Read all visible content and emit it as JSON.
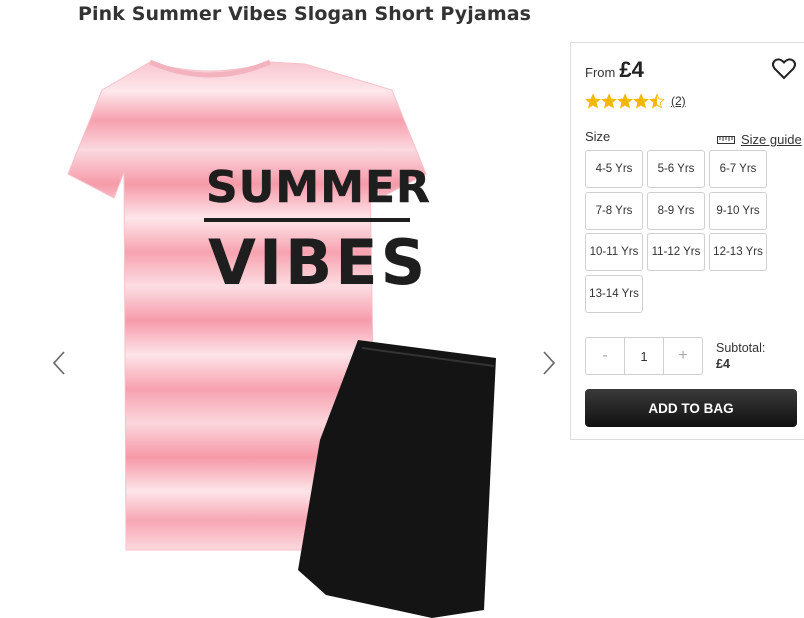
{
  "product": {
    "title": "Pink Summer Vibes Slogan Short Pyjamas",
    "image_text": [
      "SUMMER",
      "VIBES"
    ]
  },
  "purchase": {
    "from_label": "From",
    "price": "£4",
    "rating_value": 4.5,
    "rating_max": 5,
    "review_count": "(2)",
    "size_label": "Size",
    "size_guide_label": "Size guide",
    "sizes": [
      "4-5 Yrs",
      "5-6 Yrs",
      "6-7 Yrs",
      "7-8 Yrs",
      "8-9 Yrs",
      "9-10 Yrs",
      "10-11 Yrs",
      "11-12 Yrs",
      "12-13 Yrs",
      "13-14 Yrs"
    ],
    "quantity_minus": "-",
    "quantity": "1",
    "quantity_plus": "+",
    "subtotal_label": "Subtotal:",
    "subtotal_value": "£4",
    "add_to_bag": "ADD TO BAG"
  },
  "colors": {
    "star": "#f5b800",
    "button": "#1a1a1a",
    "tee_pink": "#f8a7b3",
    "shorts": "#141414"
  },
  "icons": [
    "chevron-left-icon",
    "chevron-right-icon",
    "heart-icon",
    "star-icon",
    "ruler-icon"
  ]
}
